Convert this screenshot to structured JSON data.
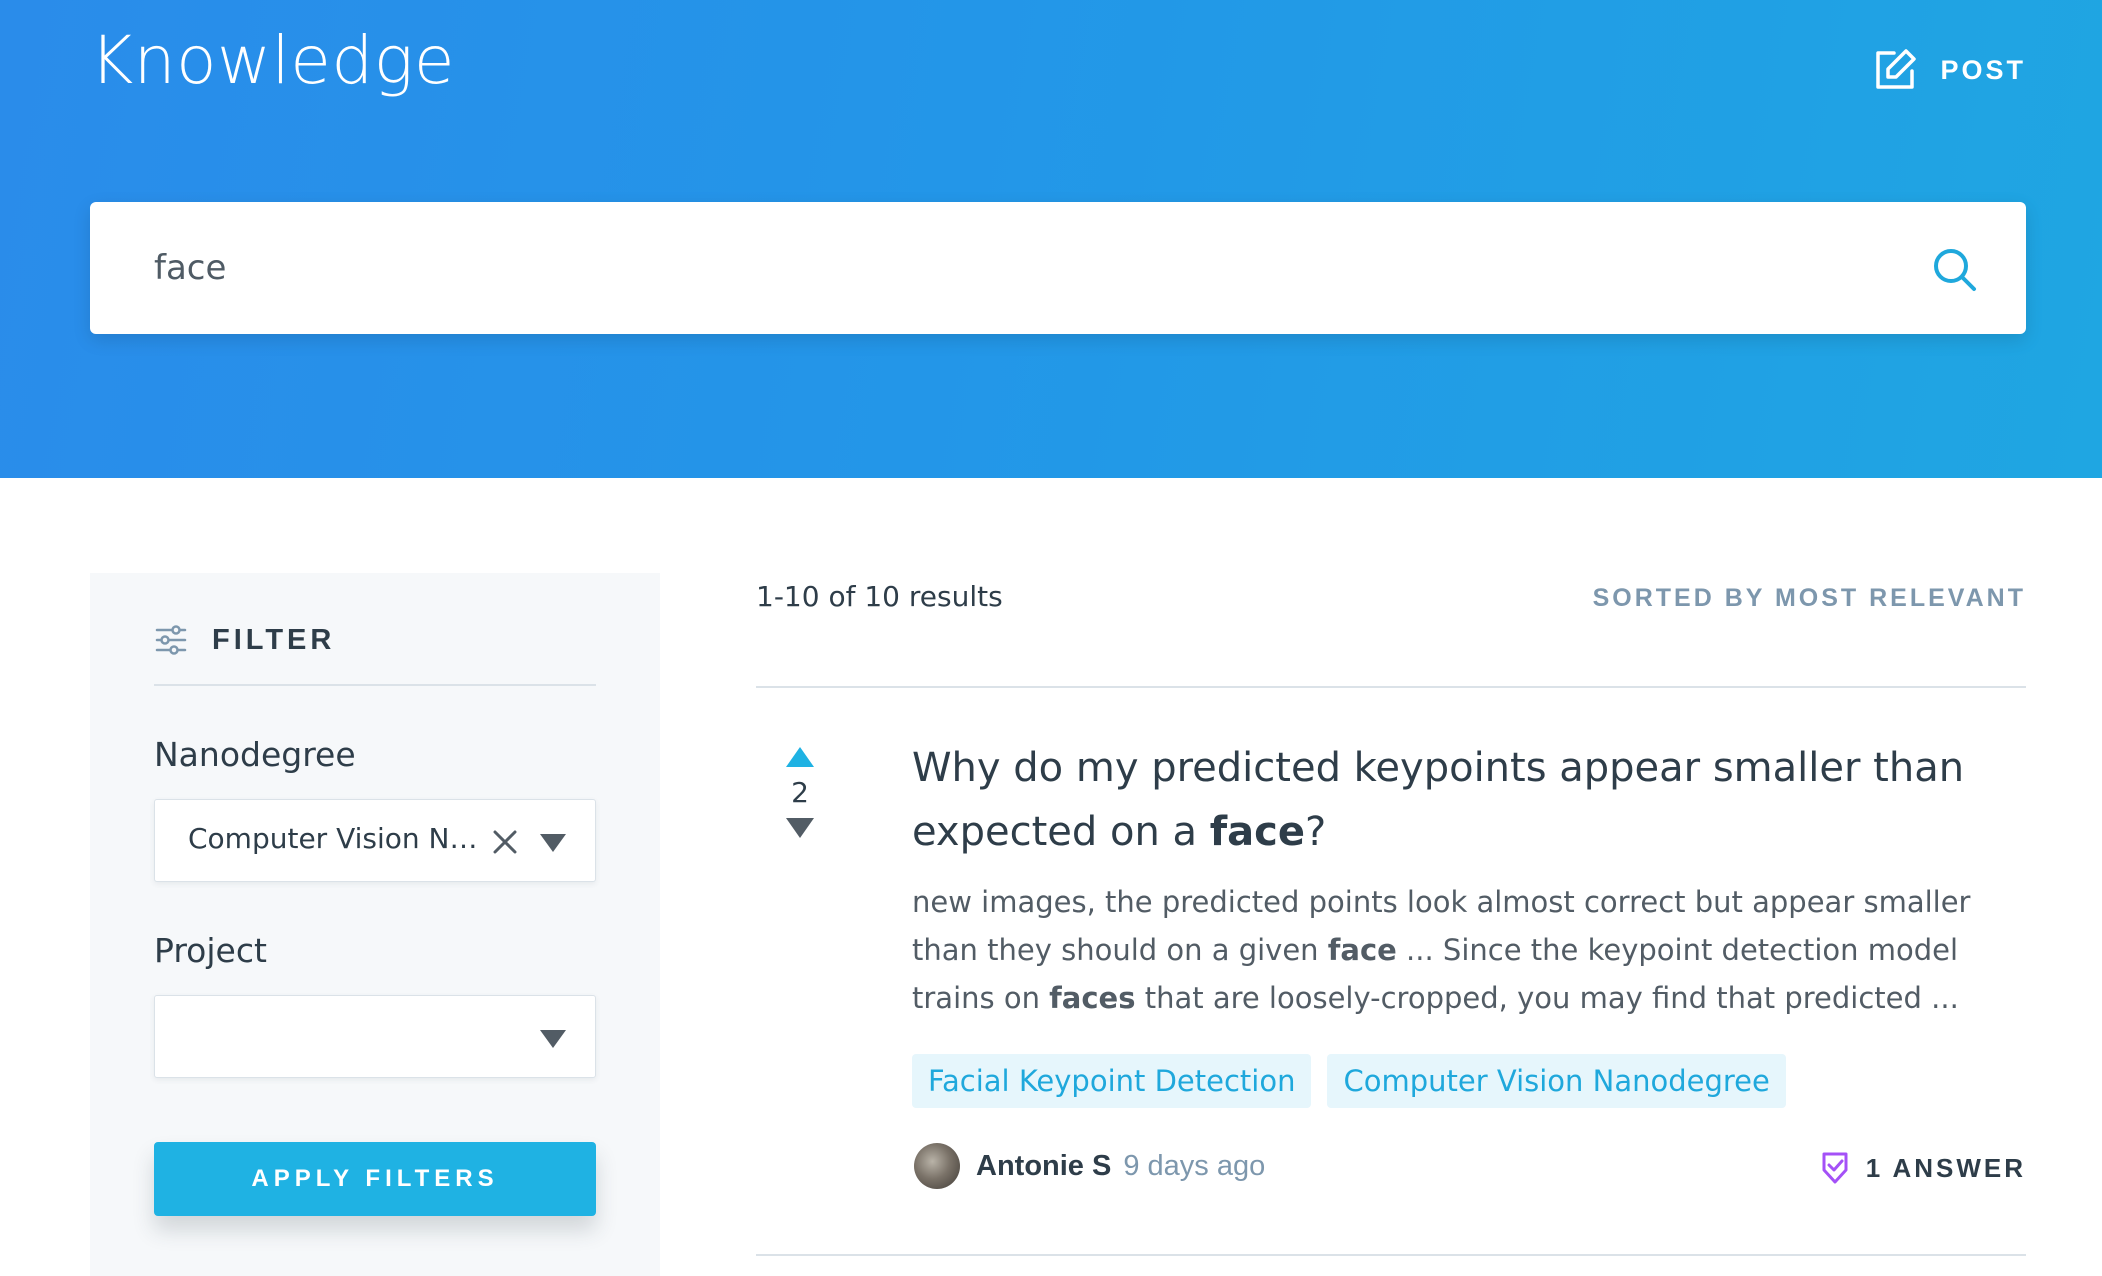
{
  "header": {
    "app_title": "Knowledge",
    "post_label": "POST",
    "post_icon": "edit-icon"
  },
  "search": {
    "value": "face",
    "icon": "search-icon"
  },
  "filter": {
    "title": "FILTER",
    "icon": "sliders-icon",
    "nanodegree_label": "Nanodegree",
    "nanodegree_value": "Computer Vision Nanodegree",
    "project_label": "Project",
    "project_value": "",
    "apply_label": "APPLY FILTERS"
  },
  "results": {
    "count_text": "1-10 of 10 results",
    "sort_text": "SORTED BY MOST RELEVANT",
    "items": [
      {
        "votes": "2",
        "title_pre": "Why do my predicted keypoints appear smaller than expected on a ",
        "title_bold": "face",
        "title_post": "?",
        "snippet_1": "new images, the predicted points look almost correct but appear smaller than they should on a given ",
        "snippet_b1": "face",
        "snippet_2": " ... Since the keypoint detection model trains on ",
        "snippet_b2": "faces",
        "snippet_3": " that are loosely-cropped, you may find that predicted ...",
        "tags": [
          "Facial Keypoint Detection",
          "Computer Vision Nanodegree"
        ],
        "author": "Antonie S",
        "time": "9 days ago",
        "answers": "1 ANSWER"
      }
    ]
  },
  "colors": {
    "header_gradient_start": "#2a8cea",
    "header_gradient_end": "#1fa6e2",
    "accent": "#1fb2e3",
    "tag_bg": "#e6f6fc",
    "answer_icon": "#a451f7"
  }
}
